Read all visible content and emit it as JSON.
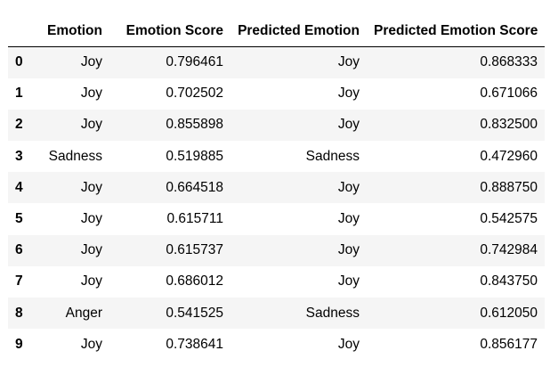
{
  "table": {
    "index_header": "",
    "columns": [
      "Emotion",
      "Emotion Score",
      "Predicted Emotion",
      "Predicted Emotion Score"
    ],
    "rows": [
      {
        "index": "0",
        "cells": [
          "Joy",
          "0.796461",
          "Joy",
          "0.868333"
        ]
      },
      {
        "index": "1",
        "cells": [
          "Joy",
          "0.702502",
          "Joy",
          "0.671066"
        ]
      },
      {
        "index": "2",
        "cells": [
          "Joy",
          "0.855898",
          "Joy",
          "0.832500"
        ]
      },
      {
        "index": "3",
        "cells": [
          "Sadness",
          "0.519885",
          "Sadness",
          "0.472960"
        ]
      },
      {
        "index": "4",
        "cells": [
          "Joy",
          "0.664518",
          "Joy",
          "0.888750"
        ]
      },
      {
        "index": "5",
        "cells": [
          "Joy",
          "0.615711",
          "Joy",
          "0.542575"
        ]
      },
      {
        "index": "6",
        "cells": [
          "Joy",
          "0.615737",
          "Joy",
          "0.742984"
        ]
      },
      {
        "index": "7",
        "cells": [
          "Joy",
          "0.686012",
          "Joy",
          "0.843750"
        ]
      },
      {
        "index": "8",
        "cells": [
          "Anger",
          "0.541525",
          "Sadness",
          "0.612050"
        ]
      },
      {
        "index": "9",
        "cells": [
          "Joy",
          "0.738641",
          "Joy",
          "0.856177"
        ]
      }
    ]
  },
  "colors": {
    "stripe": "#f5f5f5",
    "header_rule": "#000000",
    "text": "#000000"
  }
}
